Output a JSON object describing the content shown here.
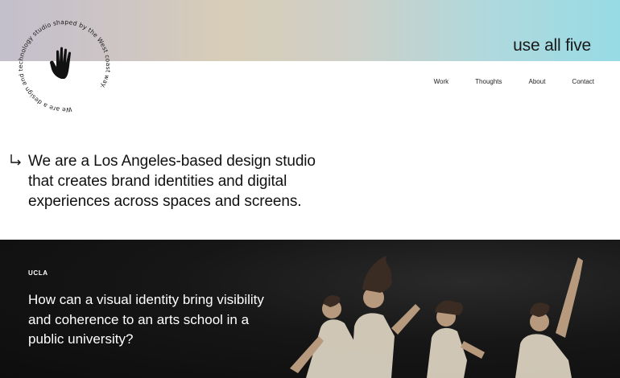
{
  "header": {
    "brand": "use all five",
    "nav": [
      {
        "label": "Work"
      },
      {
        "label": "Thoughts"
      },
      {
        "label": "About"
      },
      {
        "label": "Contact"
      }
    ]
  },
  "badge": {
    "circular_text": "We are a design and technology studio shaped by the West coast way.",
    "icon": "hand-icon"
  },
  "intro": {
    "text": "We are a Los Angeles-based design studio that creates brand identities and digital experiences across spaces and screens.",
    "icon": "arrow-down-right-icon"
  },
  "feature": {
    "eyebrow": "UCLA",
    "headline": "How can a visual identity bring visibility and coherence to an arts school in a public university?"
  },
  "colors": {
    "band_left": "#c3bfcc",
    "band_right": "#97dbe4",
    "hero_bg": "#121212"
  }
}
